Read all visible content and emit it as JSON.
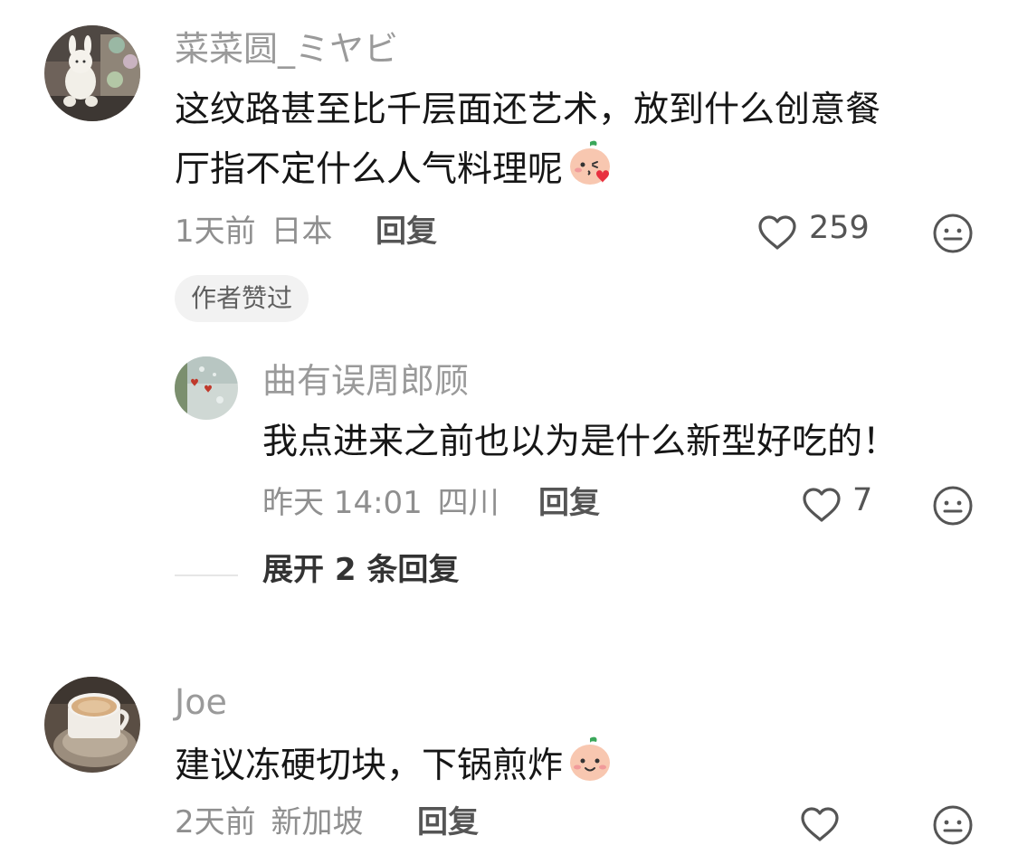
{
  "comments": [
    {
      "author": "菜菜圆_ミヤビ",
      "text_line1": "这纹路甚至比千层面还艺术，放到什么创意餐",
      "text_line2": "厅指不定什么人气料理呢",
      "emoji": "peach-kiss-emoji",
      "time": "1天前",
      "location": "日本",
      "reply_label": "回复",
      "likes": "259",
      "badge": "作者赞过",
      "avatar_icon": "plush-bunny-avatar"
    },
    {
      "author": "Joe",
      "text": "建议冻硬切块，下锅煎炸",
      "emoji": "peach-smile-emoji",
      "time": "2天前",
      "location": "新加坡",
      "reply_label": "回复",
      "likes": "",
      "avatar_icon": "coffee-cup-avatar"
    }
  ],
  "replies": [
    {
      "author": "曲有误周郎顾",
      "text": "我点进来之前也以为是什么新型好吃的！",
      "time": "昨天 14:01",
      "location": "四川",
      "reply_label": "回复",
      "likes": "7",
      "avatar_icon": "rainy-window-hearts-avatar"
    }
  ],
  "expand_replies": "展开 2 条回复",
  "icons": {
    "like": "heart-outline-icon",
    "dislike": "neutral-face-icon"
  }
}
